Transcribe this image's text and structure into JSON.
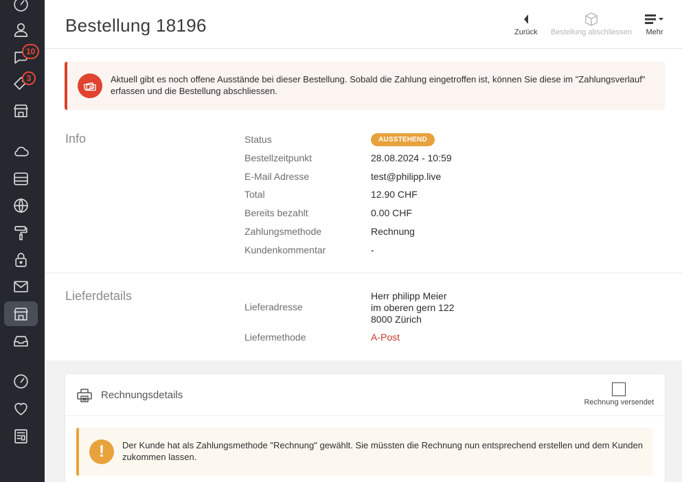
{
  "sidebar": {
    "items": [
      {
        "icon": "dashboard-icon"
      },
      {
        "icon": "user-icon"
      },
      {
        "icon": "comments-icon",
        "badge": "10"
      },
      {
        "icon": "tag-icon",
        "badge": "3"
      },
      {
        "icon": "store-icon"
      },
      {
        "icon": "cloud-icon"
      },
      {
        "icon": "server-icon"
      },
      {
        "icon": "globe-icon"
      },
      {
        "icon": "paint-roller-icon"
      },
      {
        "icon": "lock-icon"
      },
      {
        "icon": "mail-icon"
      },
      {
        "icon": "shop-icon",
        "active": true
      },
      {
        "icon": "inbox-icon"
      },
      {
        "icon": "gauge-icon"
      },
      {
        "icon": "heart-icon"
      },
      {
        "icon": "newspaper-icon"
      }
    ]
  },
  "header": {
    "title": "Bestellung 18196",
    "back_label": "Zurück",
    "close_order_label": "Bestellung abschliessen",
    "more_label": "Mehr"
  },
  "alert": {
    "text": "Aktuell gibt es noch offene Ausstände bei dieser Bestellung. Sobald die Zahlung eingetroffen ist, können Sie diese im \"Zahlungsverlauf\" erfassen und die Bestellung abschliessen."
  },
  "info": {
    "title": "Info",
    "status_label": "Status",
    "status_value": "AUSSTEHEND",
    "order_time_label": "Bestellzeitpunkt",
    "order_time_value": "28.08.2024 - 10:59",
    "email_label": "E-Mail Adresse",
    "email_value": "test@philipp.live",
    "total_label": "Total",
    "total_value": "12.90 CHF",
    "paid_label": "Bereits bezahlt",
    "paid_value": "0.00 CHF",
    "payment_method_label": "Zahlungsmethode",
    "payment_method_value": "Rechnung",
    "comment_label": "Kundenkommentar",
    "comment_value": "-"
  },
  "delivery": {
    "title": "Lieferdetails",
    "address_label": "Lieferadresse",
    "address_line1": "Herr philipp Meier",
    "address_line2": "im oberen gern 122",
    "address_line3": "8000 Zürich",
    "method_label": "Liefermethode",
    "method_value": "A-Post"
  },
  "invoice": {
    "title": "Rechnungsdetails",
    "sent_label": "Rechnung versendet",
    "alert_text": "Der Kunde hat als Zahlungsmethode \"Rechnung\" gewählt. Sie müssten die Rechnung nun entsprechend erstellen und dem Kunden zukommen lassen."
  },
  "colors": {
    "sidebar_bg": "#25282e",
    "danger": "#e0432f",
    "warning": "#e8a23c",
    "link_red": "#c0392b"
  }
}
